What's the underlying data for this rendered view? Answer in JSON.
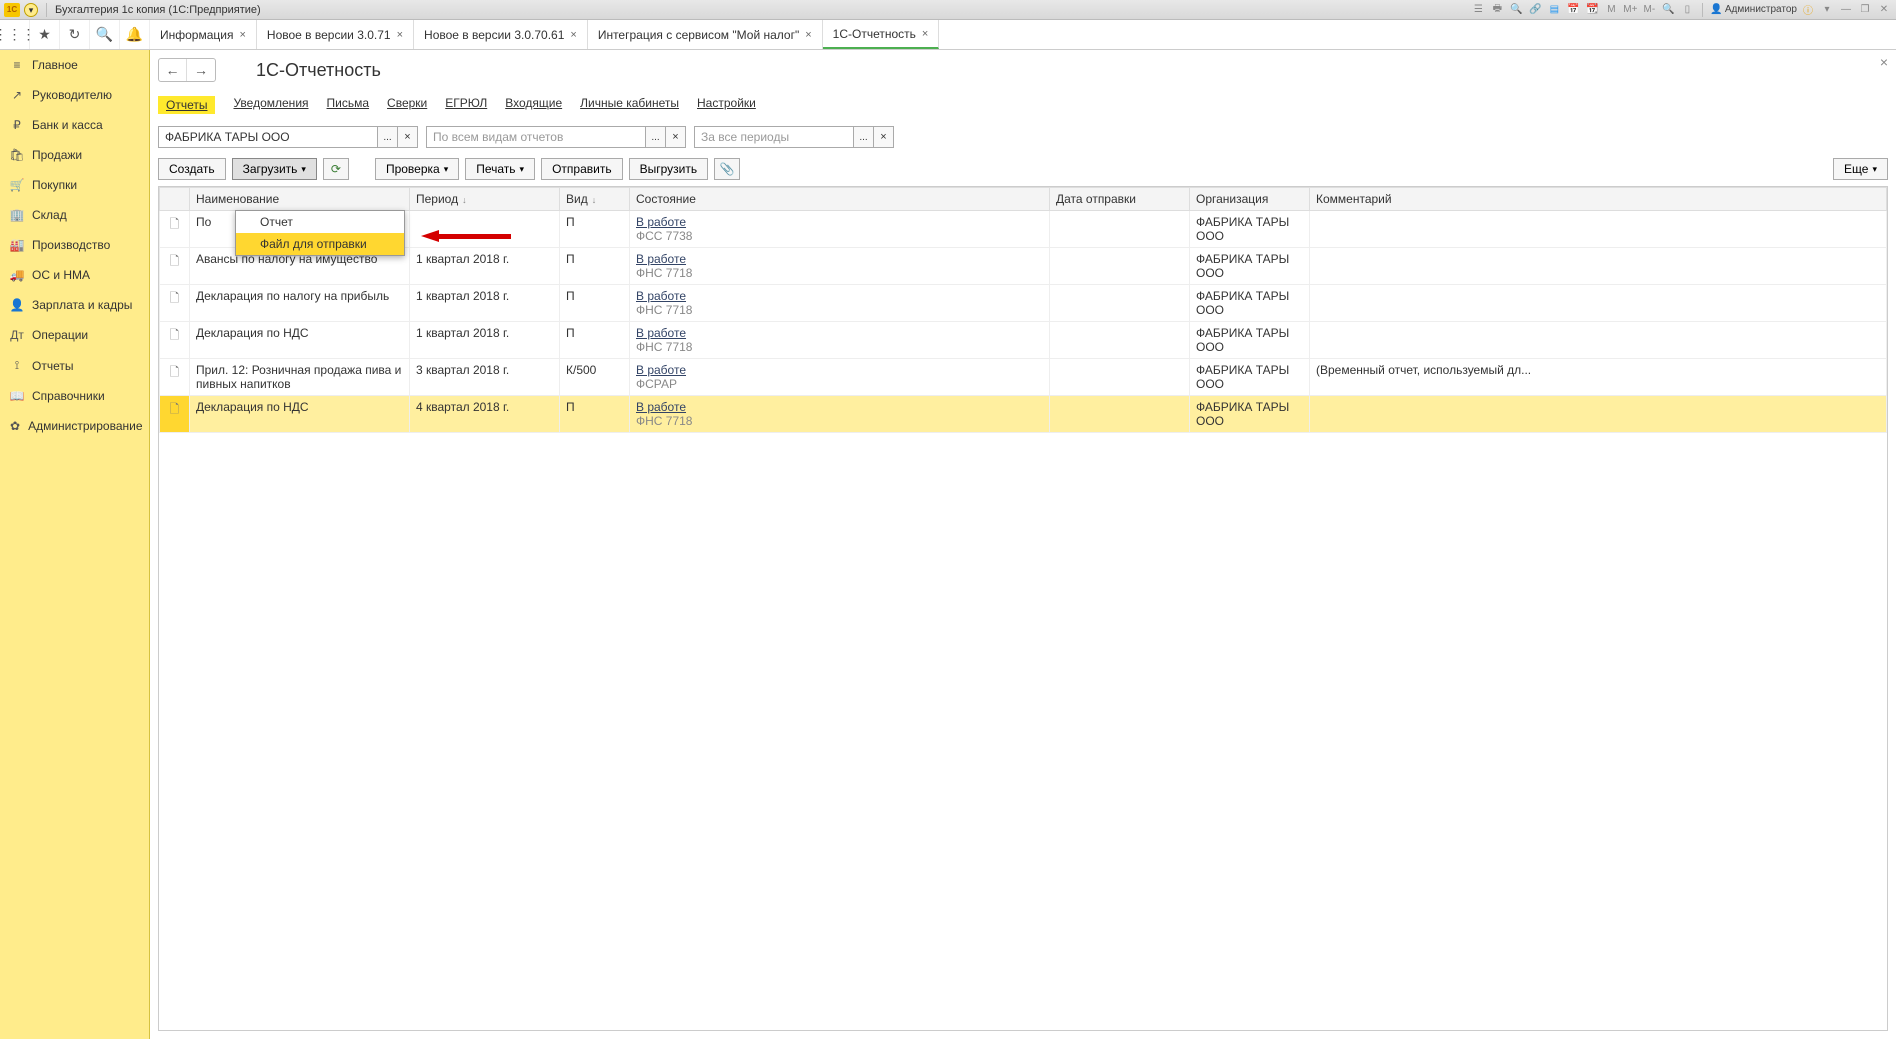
{
  "titlebar": {
    "logo_text": "1C",
    "title": "Бухгалтерия 1с копия  (1С:Предприятие)",
    "user": "Администратор",
    "icons": [
      "M",
      "M+",
      "M-"
    ]
  },
  "tabs": [
    {
      "label": "Информация"
    },
    {
      "label": "Новое в версии 3.0.71"
    },
    {
      "label": "Новое в версии 3.0.70.61"
    },
    {
      "label": "Интеграция с сервисом \"Мой налог\""
    },
    {
      "label": "1С-Отчетность",
      "active": true
    }
  ],
  "sidebar": [
    {
      "icon": "≡",
      "label": "Главное"
    },
    {
      "icon": "↗",
      "label": "Руководителю"
    },
    {
      "icon": "₽",
      "label": "Банк и касса"
    },
    {
      "icon": "🛍",
      "label": "Продажи"
    },
    {
      "icon": "🛒",
      "label": "Покупки"
    },
    {
      "icon": "🏢",
      "label": "Склад"
    },
    {
      "icon": "🏭",
      "label": "Производство"
    },
    {
      "icon": "🚚",
      "label": "ОС и НМА"
    },
    {
      "icon": "👤",
      "label": "Зарплата и кадры"
    },
    {
      "icon": "Дт",
      "label": "Операции"
    },
    {
      "icon": "⟟",
      "label": "Отчеты"
    },
    {
      "icon": "📖",
      "label": "Справочники"
    },
    {
      "icon": "✿",
      "label": "Администрирование"
    }
  ],
  "page": {
    "title": "1С-Отчетность",
    "subtabs": [
      "Отчеты",
      "Уведомления",
      "Письма",
      "Сверки",
      "ЕГРЮЛ",
      "Входящие",
      "Личные кабинеты",
      "Настройки"
    ],
    "active_subtab": 0,
    "filter_org": "ФАБРИКА ТАРЫ ООО",
    "filter_reports_placeholder": "По всем видам отчетов",
    "filter_period_placeholder": "За все периоды",
    "actions": {
      "create": "Создать",
      "load": "Загрузить",
      "check": "Проверка",
      "print": "Печать",
      "send": "Отправить",
      "export": "Выгрузить",
      "more": "Еще"
    },
    "load_menu": {
      "item1": "Отчет",
      "item2": "Файл для отправки"
    },
    "columns": {
      "name": "Наименование",
      "period": "Период",
      "vid": "Вид",
      "state": "Состояние",
      "sent": "Дата отправки",
      "org": "Организация",
      "comment": "Комментарий"
    },
    "rows": [
      {
        "name": "По",
        "period": "",
        "vid": "П",
        "state": "В работе",
        "state_sub": "ФСС 7738",
        "org": "ФАБРИКА ТАРЫ ООО",
        "comment": ""
      },
      {
        "name": "Авансы по налогу на имущество",
        "period": "1 квартал 2018 г.",
        "vid": "П",
        "state": "В работе",
        "state_sub": "ФНС 7718",
        "org": "ФАБРИКА ТАРЫ ООО",
        "comment": ""
      },
      {
        "name": "Декларация по налогу на прибыль",
        "period": "1 квартал 2018 г.",
        "vid": "П",
        "state": "В работе",
        "state_sub": "ФНС 7718",
        "org": "ФАБРИКА ТАРЫ ООО",
        "comment": ""
      },
      {
        "name": "Декларация по НДС",
        "period": "1 квартал 2018 г.",
        "vid": "П",
        "state": "В работе",
        "state_sub": "ФНС 7718",
        "org": "ФАБРИКА ТАРЫ ООО",
        "comment": ""
      },
      {
        "name": "Прил. 12: Розничная продажа пива и пивных напитков",
        "period": "3 квартал 2018 г.",
        "vid": "К/500",
        "state": "В работе",
        "state_sub": "ФСРАР",
        "org": "ФАБРИКА ТАРЫ ООО",
        "comment": "(Временный отчет, используемый дл..."
      },
      {
        "name": "Декларация по НДС",
        "period": "4 квартал 2018 г.",
        "vid": "П",
        "state": "В работе",
        "state_sub": "ФНС 7718",
        "org": "ФАБРИКА ТАРЫ ООО",
        "comment": "",
        "selected": true
      }
    ]
  }
}
